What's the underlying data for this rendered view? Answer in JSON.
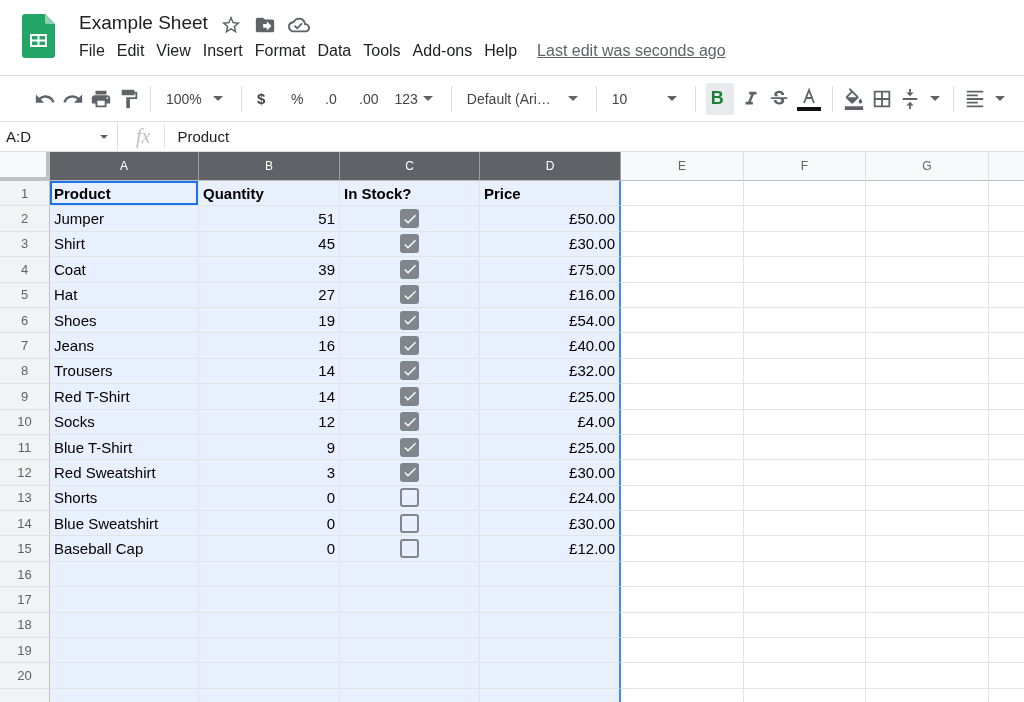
{
  "document": {
    "title": "Example Sheet",
    "last_edit": "Last edit was seconds ago"
  },
  "menu": [
    "File",
    "Edit",
    "View",
    "Insert",
    "Format",
    "Data",
    "Tools",
    "Add-ons",
    "Help"
  ],
  "toolbar": {
    "zoom": "100%",
    "currency": "$",
    "percent": "%",
    "decrease_decimals": ".0",
    "increase_decimals": ".00",
    "number_format": "123",
    "font": "Default (Ari…",
    "font_size": "10",
    "bold": {
      "label": "B",
      "active": true
    }
  },
  "formula_bar": {
    "name_box": "A:D",
    "function_label": "fx",
    "formula": "Product"
  },
  "columns": [
    {
      "label": "A",
      "selected": true
    },
    {
      "label": "B",
      "selected": true
    },
    {
      "label": "C",
      "selected": true
    },
    {
      "label": "D",
      "selected": true
    },
    {
      "label": "E",
      "selected": false
    },
    {
      "label": "F",
      "selected": false
    },
    {
      "label": "G",
      "selected": false
    }
  ],
  "header_row": {
    "number": "1",
    "cells": [
      {
        "text": "Product",
        "selected": true
      },
      {
        "text": "Quantity",
        "selected": false
      },
      {
        "text": "In Stock?",
        "selected": false
      },
      {
        "text": "Price",
        "selected": false
      }
    ]
  },
  "rows": [
    {
      "number": "2",
      "product": "Jumper",
      "quantity": "51",
      "in_stock": true,
      "price": "£50.00"
    },
    {
      "number": "3",
      "product": "Shirt",
      "quantity": "45",
      "in_stock": true,
      "price": "£30.00"
    },
    {
      "number": "4",
      "product": "Coat",
      "quantity": "39",
      "in_stock": true,
      "price": "£75.00"
    },
    {
      "number": "5",
      "product": "Hat",
      "quantity": "27",
      "in_stock": true,
      "price": "£16.00"
    },
    {
      "number": "6",
      "product": "Shoes",
      "quantity": "19",
      "in_stock": true,
      "price": "£54.00"
    },
    {
      "number": "7",
      "product": "Jeans",
      "quantity": "16",
      "in_stock": true,
      "price": "£40.00"
    },
    {
      "number": "8",
      "product": "Trousers",
      "quantity": "14",
      "in_stock": true,
      "price": "£32.00"
    },
    {
      "number": "9",
      "product": "Red T-Shirt",
      "quantity": "14",
      "in_stock": true,
      "price": "£25.00"
    },
    {
      "number": "10",
      "product": "Socks",
      "quantity": "12",
      "in_stock": true,
      "price": "£4.00"
    },
    {
      "number": "11",
      "product": "Blue T-Shirt",
      "quantity": "9",
      "in_stock": true,
      "price": "£25.00"
    },
    {
      "number": "12",
      "product": "Red Sweatshirt",
      "quantity": "3",
      "in_stock": true,
      "price": "£30.00"
    },
    {
      "number": "13",
      "product": "Shorts",
      "quantity": "0",
      "in_stock": false,
      "price": "£24.00"
    },
    {
      "number": "14",
      "product": "Blue Sweatshirt",
      "quantity": "0",
      "in_stock": false,
      "price": "£30.00"
    },
    {
      "number": "15",
      "product": "Baseball Cap",
      "quantity": "0",
      "in_stock": false,
      "price": "£12.00"
    }
  ],
  "empty_rows": [
    "16",
    "17",
    "18",
    "19",
    "20"
  ]
}
